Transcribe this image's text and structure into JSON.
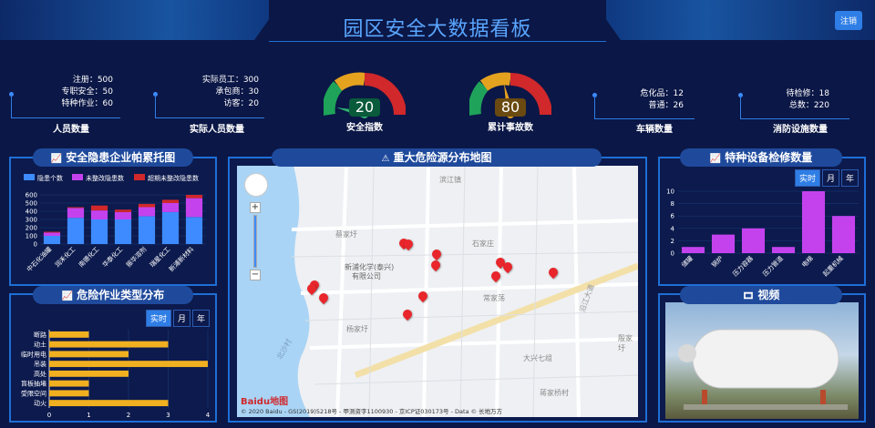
{
  "header": {
    "title": "园区安全大数据看板",
    "logout_label": "注销"
  },
  "stats": {
    "personnel": {
      "lines": [
        "注册：500",
        "专职安全：50",
        "特种作业：60"
      ],
      "caption": "人员数量"
    },
    "actual": {
      "lines": [
        "实际员工：300",
        "承包商：30",
        "访客：20"
      ],
      "caption": "实际人员数量"
    },
    "safety_index": {
      "value": "20",
      "caption": "安全指数"
    },
    "accidents": {
      "value": "80",
      "caption": "累计事故数"
    },
    "vehicles": {
      "lines": [
        "危化品：12",
        "普通：26"
      ],
      "caption": "车辆数量"
    },
    "fire": {
      "lines": [
        "待检修：18",
        "总数：220"
      ],
      "caption": "消防设施数量"
    }
  },
  "panels": {
    "pareto": {
      "title": "安全隐患企业帕累托图"
    },
    "work_types": {
      "title": "危险作业类型分布",
      "tabs": [
        "实时",
        "月",
        "年"
      ]
    },
    "map": {
      "title": "重大危险源分布地图",
      "labels": [
        "滨江镇",
        "蔡家圩",
        "石家庄",
        "新浦化学(泰兴)",
        "有限公司",
        "常家荡",
        "杨家圩",
        "沿江大道",
        "殷家圩",
        "大兴七组",
        "蒋家桥村",
        "北沙村"
      ],
      "copyright": "© 2020 Baidu - GS(2019)5218号 - 甲测资字1100930 - 京ICP证030173号 - Data © 长地万方",
      "logo": "Baidu地图"
    },
    "equipment": {
      "title": "特种设备检修数量",
      "tabs": [
        "实时",
        "月",
        "年"
      ]
    },
    "video": {
      "title": "视频"
    }
  },
  "chart_data": [
    {
      "type": "bar",
      "title": "安全隐患企业帕累托图",
      "categories": [
        "中石化油罐",
        "润禾化工",
        "南德化工",
        "华泰化工",
        "振华溶剂",
        "瑞星化工",
        "新浦新材料"
      ],
      "series": [
        {
          "name": "隐患个数",
          "values": [
            100,
            320,
            300,
            300,
            340,
            390,
            330
          ],
          "color": "#3d8bff"
        },
        {
          "name": "未整改隐患数",
          "values": [
            40,
            120,
            110,
            90,
            110,
            110,
            230
          ],
          "color": "#c442ee"
        },
        {
          "name": "超期未整改隐患数",
          "values": [
            10,
            10,
            60,
            30,
            40,
            40,
            40
          ],
          "color": "#d0282b"
        }
      ],
      "stacked": true,
      "ylim": [
        0,
        600
      ],
      "yticks": [
        0,
        100,
        200,
        300,
        400,
        500,
        600
      ],
      "legend": "top"
    },
    {
      "type": "bar",
      "orientation": "horizontal",
      "title": "危险作业类型分布",
      "categories": [
        "断路",
        "动土",
        "临时用电",
        "吊装",
        "高处",
        "盲板抽堵",
        "受限空间",
        "动火"
      ],
      "values": [
        1,
        3,
        2,
        4,
        2,
        1,
        1,
        3
      ],
      "color": "#f0b020",
      "xlim": [
        0,
        4
      ],
      "xticks": [
        0,
        1,
        2,
        3,
        4
      ]
    },
    {
      "type": "bar",
      "title": "特种设备检修数量",
      "categories": [
        "储罐",
        "锅炉",
        "压力容器",
        "压力管道",
        "电梯",
        "起重机械"
      ],
      "values": [
        1,
        3,
        4,
        1,
        10,
        6
      ],
      "color": "#c442ee",
      "ylim": [
        0,
        10
      ],
      "yticks": [
        0,
        2,
        4,
        6,
        8,
        10
      ]
    }
  ]
}
